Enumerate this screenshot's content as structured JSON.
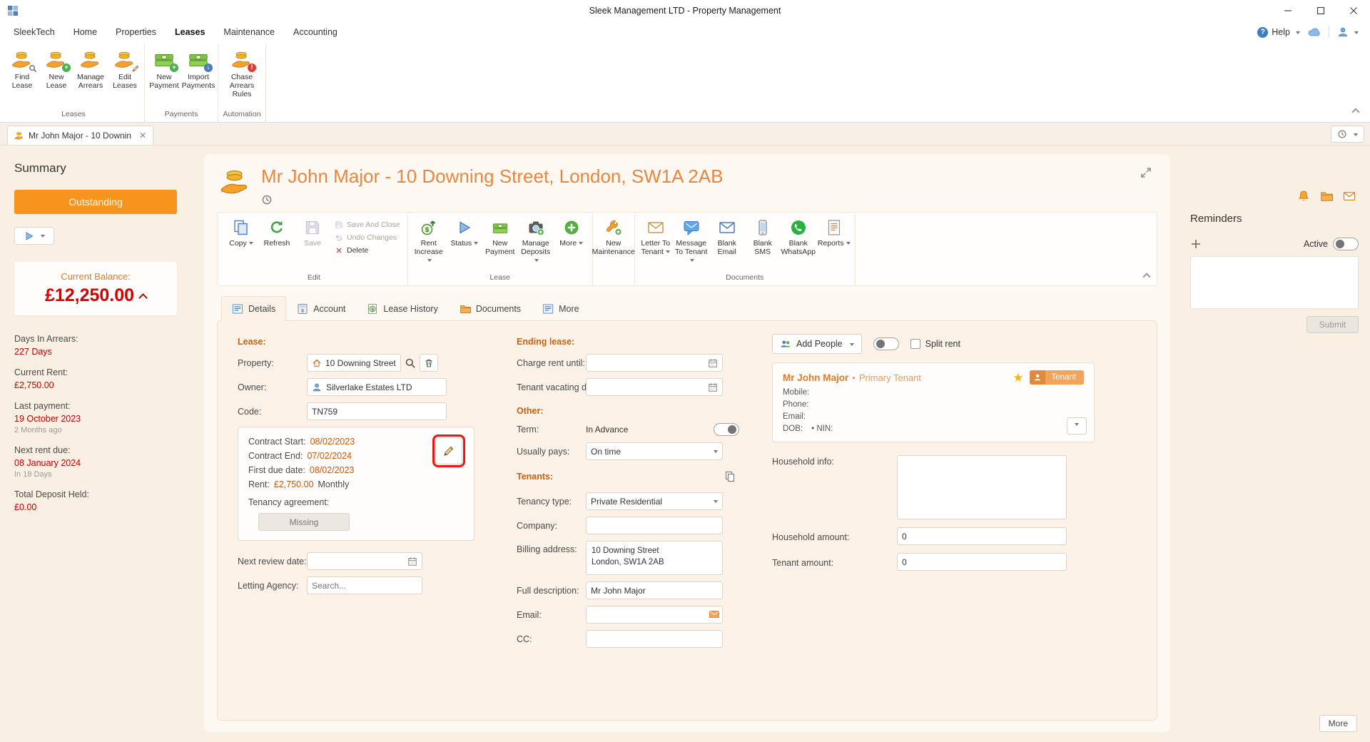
{
  "titlebar": {
    "title": "Sleek Management LTD - Property Management"
  },
  "menubar": {
    "items": [
      {
        "label": "SleekTech"
      },
      {
        "label": "Home"
      },
      {
        "label": "Properties"
      },
      {
        "label": "Leases"
      },
      {
        "label": "Maintenance"
      },
      {
        "label": "Accounting"
      }
    ],
    "help_label": "Help"
  },
  "ribbon": {
    "groups": [
      {
        "name": "Leases",
        "buttons": [
          {
            "label": "Find Lease"
          },
          {
            "label": "New Lease"
          },
          {
            "label": "Manage Arrears"
          },
          {
            "label": "Edit Leases"
          }
        ]
      },
      {
        "name": "Payments",
        "buttons": [
          {
            "label": "New Payment"
          },
          {
            "label": "Import Payments"
          }
        ]
      },
      {
        "name": "Automation",
        "buttons": [
          {
            "label": "Chase Arrears Rules"
          }
        ]
      }
    ]
  },
  "doctab": {
    "label": "Mr John Major - 10 Downin"
  },
  "summary": {
    "title": "Summary",
    "status_button": "Outstanding",
    "balance_label": "Current Balance:",
    "balance_value": "£12,250.00",
    "stats": [
      {
        "label": "Days In Arrears:",
        "value": "227 Days",
        "sub": ""
      },
      {
        "label": "Current Rent:",
        "value": "£2,750.00",
        "sub": ""
      },
      {
        "label": "Last payment:",
        "value": "19 October 2023",
        "sub": "2 Months ago"
      },
      {
        "label": "Next rent due:",
        "value": "08 January 2024",
        "sub": "In 18 Days"
      },
      {
        "label": "Total Deposit Held:",
        "value": "£0.00",
        "sub": ""
      }
    ]
  },
  "main": {
    "title": "Mr John Major - 10 Downing Street, London, SW1A 2AB",
    "toolbar": {
      "copy": "Copy",
      "refresh": "Refresh",
      "save": "Save",
      "save_and_close": "Save And Close",
      "undo_changes": "Undo Changes",
      "delete": "Delete",
      "edit_group": "Edit",
      "rent_increase": "Rent Increase",
      "status": "Status",
      "new_payment": "New Payment",
      "manage_deposits": "Manage Deposits",
      "more": "More",
      "lease_group": "Lease",
      "new_maintenance": "New Maintenance",
      "letter_to_tenant": "Letter To Tenant",
      "message_to_tenant": "Message To Tenant",
      "blank_email": "Blank Email",
      "blank_sms": "Blank SMS",
      "blank_whatsapp": "Blank WhatsApp",
      "reports": "Reports",
      "documents_group": "Documents"
    },
    "tabs": [
      {
        "label": "Details"
      },
      {
        "label": "Account"
      },
      {
        "label": "Lease History"
      },
      {
        "label": "Documents"
      },
      {
        "label": "More"
      }
    ]
  },
  "form": {
    "lease_title": "Lease:",
    "property_label": "Property:",
    "property_value": "10 Downing Street",
    "owner_label": "Owner:",
    "owner_value": "Silverlake Estates LTD",
    "code_label": "Code:",
    "code_value": "TN759",
    "contract": {
      "rows": [
        {
          "label": "Contract Start:",
          "value": "08/02/2023",
          "extra": ""
        },
        {
          "label": "Contract End:",
          "value": "07/02/2024",
          "extra": ""
        },
        {
          "label": "First due date:",
          "value": "08/02/2023",
          "extra": ""
        },
        {
          "label": "Rent:",
          "value": "£2,750.00",
          "extra": "Monthly"
        }
      ],
      "agreement_label": "Tenancy agreement:",
      "agreement_status": "Missing"
    },
    "next_review_label": "Next review date:",
    "letting_agency_label": "Letting Agency:",
    "letting_agency_placeholder": "Search...",
    "ending_title": "Ending lease:",
    "charge_rent_label": "Charge rent until:",
    "vacating_label": "Tenant vacating date:",
    "other_title": "Other:",
    "term_label": "Term:",
    "term_value": "In Advance",
    "usually_pays_label": "Usually pays:",
    "usually_pays_value": "On time",
    "tenants_title": "Tenants:",
    "tenancy_type_label": "Tenancy type:",
    "tenancy_type_value": "Private Residential",
    "company_label": "Company:",
    "billing_label": "Billing address:",
    "billing_value": "10 Downing Street\nLondon, SW1A 2AB",
    "full_desc_label": "Full description:",
    "full_desc_value": "Mr John Major",
    "email_label": "Email:",
    "cc_label": "CC:",
    "add_people": "Add People",
    "split_rent": "Split rent",
    "tenant_card": {
      "name": "Mr John Major",
      "separator": "•",
      "role": "Primary Tenant",
      "badge": "Tenant",
      "mobile_label": "Mobile:",
      "phone_label": "Phone:",
      "email_label": "Email:",
      "dob_label": "DOB:",
      "nin_label": "• NIN:"
    },
    "household_info_label": "Household info:",
    "household_amount_label": "Household amount:",
    "household_amount_value": "0",
    "tenant_amount_label": "Tenant amount:",
    "tenant_amount_value": "0"
  },
  "reminders": {
    "title": "Reminders",
    "active_label": "Active",
    "submit": "Submit",
    "more": "More"
  }
}
